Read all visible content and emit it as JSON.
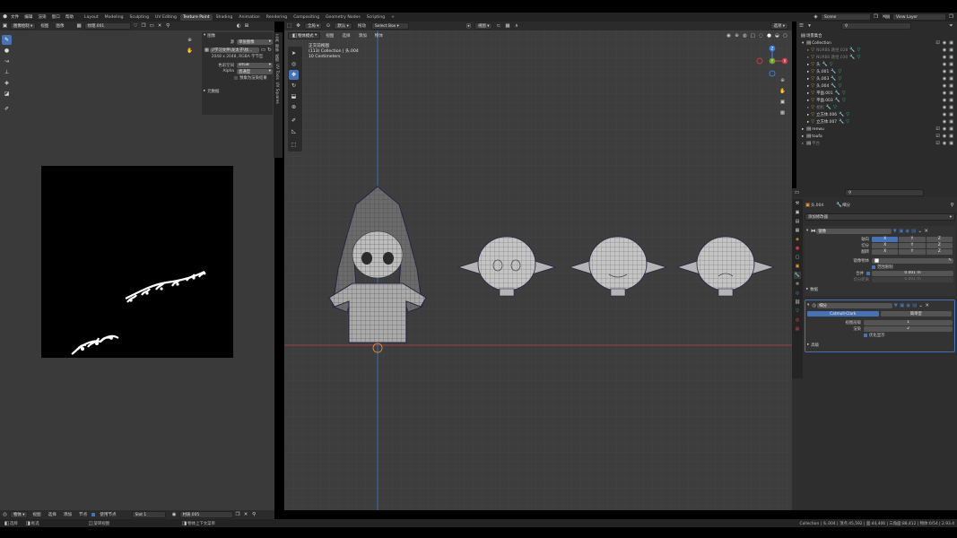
{
  "menubar": {
    "menus": [
      "文件",
      "编辑",
      "渲染",
      "窗口",
      "帮助"
    ],
    "workspaces": [
      "Layout",
      "Modeling",
      "Sculpting",
      "UV Editing",
      "Texture Paint",
      "Shading",
      "Animation",
      "Rendering",
      "Compositing",
      "Geometry Nodes",
      "Scripting"
    ],
    "active_workspace": "Texture Paint",
    "scene_label": "Scene",
    "view_layer_label": "View Layer"
  },
  "image_editor": {
    "mode": "图像绘制",
    "view_menu": "视图",
    "image_menu": "图像",
    "image_name": "纹理.001",
    "panel": {
      "section_image": "图像",
      "source_label": "源",
      "source_value": "单张图像",
      "filepath": "//学习文件\\龙太子\\纹...",
      "info": "2048 x 2048, RGBA 字节型",
      "colorspace_label": "色彩空间",
      "colorspace_value": "sRGB",
      "alpha_label": "Alpha",
      "alpha_value": "直通型",
      "premult_label": "预乘为渲染结果",
      "section_meta": "元数据"
    },
    "side_tabs": [
      "工具",
      "图像",
      "视图",
      "UV Tools",
      "UV Squares"
    ]
  },
  "viewport": {
    "mode": "物体模式",
    "menus": [
      "视图",
      "选择",
      "添加",
      "物体"
    ],
    "global_label": "全局",
    "pivot_label": "默认",
    "drag_label": "拖动",
    "select_box_label": "Select Box",
    "view_label": "选项",
    "info_title": "正交前视图",
    "info_collection": "(113) Collection | 头.004",
    "info_scale": "10 Centimeters",
    "gizmo_axes": [
      "Z",
      "Y",
      "X"
    ]
  },
  "outliner": {
    "search_placeholder": "",
    "root": "场景集合",
    "collection": "Collection",
    "items": [
      {
        "name": "NURBS 路径.028",
        "dim": true
      },
      {
        "name": "NURBS 路径.030",
        "dim": true
      },
      {
        "name": "头",
        "dim": false
      },
      {
        "name": "头.001",
        "dim": false
      },
      {
        "name": "头.003",
        "dim": false
      },
      {
        "name": "头.004",
        "dim": false
      },
      {
        "name": "平面.001",
        "dim": false
      },
      {
        "name": "平面.003",
        "dim": false
      },
      {
        "name": "相机",
        "dim": true
      },
      {
        "name": "立方体.006",
        "dim": false
      },
      {
        "name": "立方体.007",
        "dim": false
      }
    ],
    "collections": [
      {
        "name": "renwu",
        "dim": false
      },
      {
        "name": "toufa",
        "dim": false
      },
      {
        "name": "平台",
        "dim": true
      }
    ]
  },
  "properties": {
    "object_name": "头.004",
    "modifier_tab_label": "细分",
    "add_modifier": "添加修改器",
    "mirror": {
      "name": "镜像",
      "axis_label": "轴向",
      "bisect_label": "切分",
      "flip_label": "翻转",
      "axes": [
        "X",
        "Y",
        "Z"
      ],
      "mirror_object_label": "镜像物体",
      "clipping_label": "范围限制",
      "merge_label": "合并",
      "merge_value": "0.001 m",
      "bisect_dist_label": "切分距离",
      "bisect_dist_value": "0.001 m",
      "data_label": "数据"
    },
    "subsurf": {
      "name": "细分",
      "catmull": "Catmull-Clark",
      "simple": "简单型",
      "levels_viewport_label": "视图层级",
      "levels_viewport_value": "1",
      "render_label": "渲染",
      "render_value": "2",
      "optimal_label": "优化显示",
      "advanced_label": "高级"
    }
  },
  "bottom_bar": {
    "mode": "物体",
    "menus": [
      "视图",
      "选择",
      "添加",
      "节点"
    ],
    "use_nodes_label": "使用节点",
    "slot_label": "Slot 1",
    "material_name": "材质.005"
  },
  "status_bar": {
    "select_label": "选择",
    "box_select_label": "框选",
    "rotate_label": "旋转视图",
    "context_label": "物体上下文菜单",
    "stats": "Collection | 头.004 | 顶点:45,592 | 面:44,406 | 三角面:88,412 | 物体:0/54 | 2.93.4"
  },
  "colors": {
    "accent_blue": "#4772b3",
    "mesh_orange": "#e59b3a",
    "modifier_teal": "#2fc3a3",
    "x_axis_red": "#c23b4a",
    "y_axis_green": "#6aa22f",
    "z_axis_blue": "#3b7dd8"
  }
}
